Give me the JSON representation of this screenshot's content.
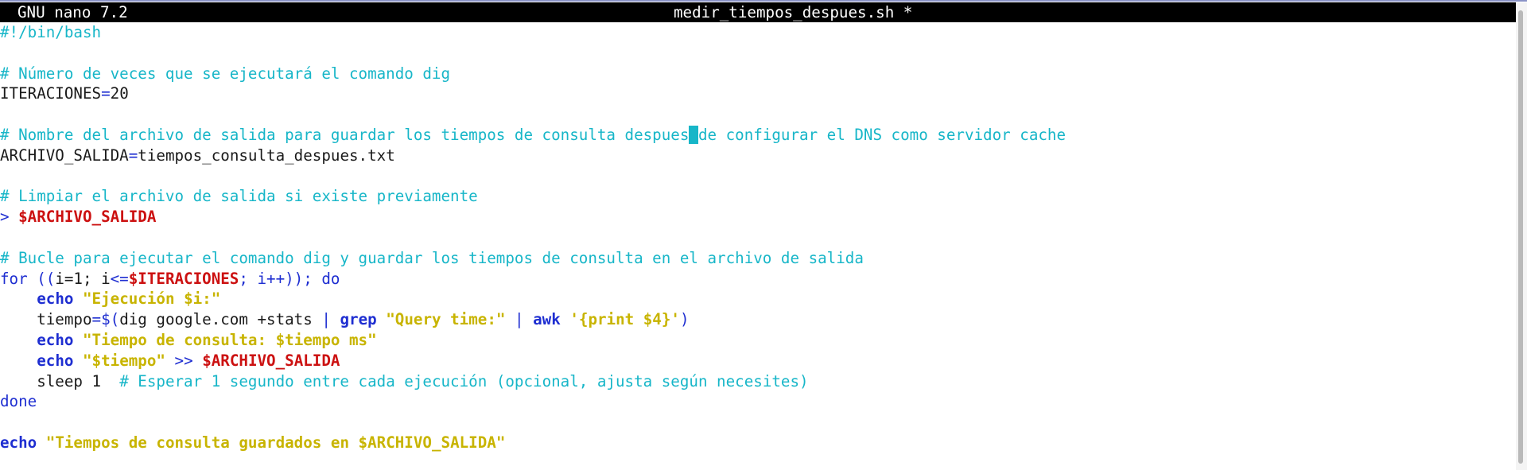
{
  "app": {
    "name": "GNU nano 7.2",
    "filename": "medir_tiempos_despues.sh *"
  },
  "editor": {
    "lines": [
      [
        {
          "t": "#!/bin/bash",
          "k": "comment"
        }
      ],
      [],
      [
        {
          "t": "# Número de veces que se ejecutará el comando dig",
          "k": "comment"
        }
      ],
      [
        {
          "t": "ITERACIONES",
          "k": "plain"
        },
        {
          "t": "=",
          "k": "op"
        },
        {
          "t": "20",
          "k": "plain"
        }
      ],
      [],
      [
        {
          "t": "# Nombre del archivo de salida para guardar los tiempos de consulta despues",
          "k": "comment"
        },
        {
          "t": " ",
          "k": "cursor"
        },
        {
          "t": "de configurar el DNS como servidor cache",
          "k": "comment"
        }
      ],
      [
        {
          "t": "ARCHIVO_SALIDA",
          "k": "plain"
        },
        {
          "t": "=",
          "k": "op"
        },
        {
          "t": "tiempos_consulta_despues.txt",
          "k": "plain"
        }
      ],
      [],
      [
        {
          "t": "# Limpiar el archivo de salida si existe previamente",
          "k": "comment"
        }
      ],
      [
        {
          "t": "> ",
          "k": "op"
        },
        {
          "t": "$ARCHIVO_SALIDA",
          "k": "var"
        }
      ],
      [],
      [
        {
          "t": "# Bucle para ejecutar el comando dig y guardar los tiempos de consulta en el archivo de salida",
          "k": "comment"
        }
      ],
      [
        {
          "t": "for",
          "k": "ctl"
        },
        {
          "t": " ((",
          "k": "op"
        },
        {
          "t": "i=1; i",
          "k": "plain"
        },
        {
          "t": "<=",
          "k": "op"
        },
        {
          "t": "$ITERACIONES",
          "k": "var"
        },
        {
          "t": "; i++)); ",
          "k": "op"
        },
        {
          "t": "do",
          "k": "ctl"
        }
      ],
      [
        {
          "t": "    ",
          "k": "plain"
        },
        {
          "t": "echo",
          "k": "kw"
        },
        {
          "t": " ",
          "k": "plain"
        },
        {
          "t": "\"Ejecución $i:\"",
          "k": "str"
        }
      ],
      [
        {
          "t": "    tiempo",
          "k": "plain"
        },
        {
          "t": "=$(",
          "k": "op"
        },
        {
          "t": "dig google.com +stats ",
          "k": "plain"
        },
        {
          "t": "|",
          "k": "op"
        },
        {
          "t": " ",
          "k": "plain"
        },
        {
          "t": "grep",
          "k": "kw"
        },
        {
          "t": " ",
          "k": "plain"
        },
        {
          "t": "\"Query time:\"",
          "k": "str"
        },
        {
          "t": " ",
          "k": "plain"
        },
        {
          "t": "|",
          "k": "op"
        },
        {
          "t": " ",
          "k": "plain"
        },
        {
          "t": "awk",
          "k": "kw"
        },
        {
          "t": " ",
          "k": "plain"
        },
        {
          "t": "'{print $4}'",
          "k": "str"
        },
        {
          "t": ")",
          "k": "op"
        }
      ],
      [
        {
          "t": "    ",
          "k": "plain"
        },
        {
          "t": "echo",
          "k": "kw"
        },
        {
          "t": " ",
          "k": "plain"
        },
        {
          "t": "\"Tiempo de consulta: $tiempo ms\"",
          "k": "str"
        }
      ],
      [
        {
          "t": "    ",
          "k": "plain"
        },
        {
          "t": "echo",
          "k": "kw"
        },
        {
          "t": " ",
          "k": "plain"
        },
        {
          "t": "\"$tiempo\"",
          "k": "str"
        },
        {
          "t": " >> ",
          "k": "op"
        },
        {
          "t": "$ARCHIVO_SALIDA",
          "k": "var"
        }
      ],
      [
        {
          "t": "    sleep 1  ",
          "k": "plain"
        },
        {
          "t": "# Esperar 1 segundo entre cada ejecución (opcional, ajusta según necesites)",
          "k": "comment"
        }
      ],
      [
        {
          "t": "done",
          "k": "ctl"
        }
      ],
      [],
      [
        {
          "t": "echo",
          "k": "kw"
        },
        {
          "t": " ",
          "k": "plain"
        },
        {
          "t": "\"Tiempos de consulta guardados en $ARCHIVO_SALIDA\"",
          "k": "str"
        }
      ]
    ]
  },
  "colors": {
    "comment": "#17b6c8",
    "keyword": "#1e2ed1",
    "variable": "#cc1111",
    "string": "#c8b400",
    "titlebar_bg": "#000000",
    "titlebar_fg": "#ffffff"
  }
}
